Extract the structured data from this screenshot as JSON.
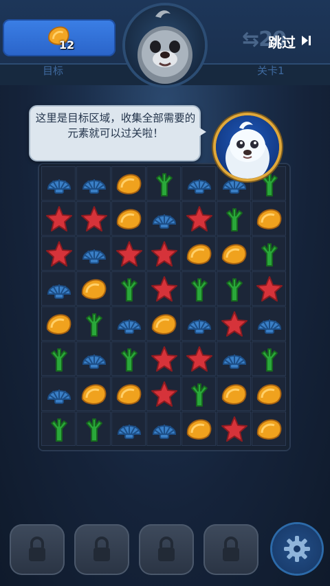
{
  "header": {
    "goal_count": "12",
    "goal_label": "目标",
    "level_label": "关卡1",
    "moves_value": "20",
    "skip_label": "跳过"
  },
  "tutorial": {
    "message": "这里是目标区域，收集全部需要的元素就可以过关啦！"
  },
  "colors": {
    "shell_blue": "#3a7fc6",
    "starfish_red": "#d6333a",
    "conch_yellow": "#f0a21e",
    "coral_green": "#2aa83a",
    "goal_panel": "#2f6fd8"
  },
  "board": {
    "cols": 7,
    "rows": 8,
    "cells": [
      [
        "shell",
        "shell",
        "conch",
        "coral",
        "shell",
        "shell",
        "coral"
      ],
      [
        "star",
        "star",
        "conch",
        "shell",
        "star",
        "coral",
        "conch"
      ],
      [
        "star",
        "shell",
        "star",
        "star",
        "conch",
        "conch",
        "coral"
      ],
      [
        "shell",
        "conch",
        "coral",
        "star",
        "coral",
        "coral",
        "star"
      ],
      [
        "conch",
        "coral",
        "shell",
        "conch",
        "shell",
        "star",
        "shell"
      ],
      [
        "coral",
        "shell",
        "coral",
        "star",
        "star",
        "shell",
        "coral"
      ],
      [
        "shell",
        "conch",
        "conch",
        "star",
        "coral",
        "conch",
        "conch"
      ],
      [
        "coral",
        "coral",
        "shell",
        "shell",
        "conch",
        "star",
        "conch"
      ]
    ]
  },
  "bottom": {
    "locked_boosters": 4,
    "settings_icon": "gear-icon"
  }
}
